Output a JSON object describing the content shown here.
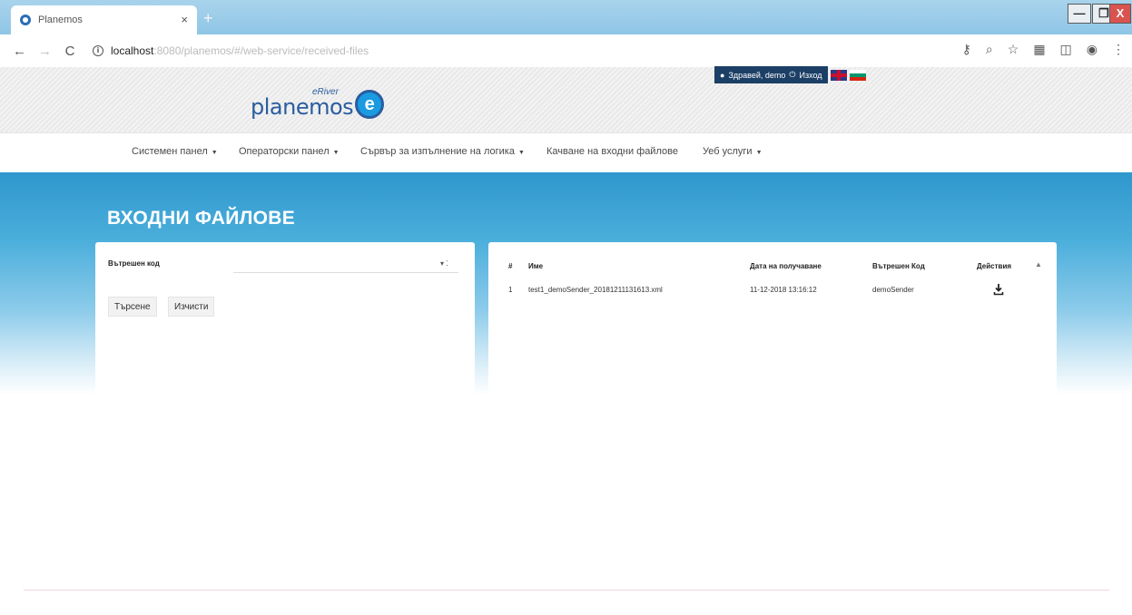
{
  "browser": {
    "tab_title": "Planemos",
    "tab_close": "×",
    "new_tab": "+",
    "url_host": "localhost",
    "url_rest": ":8080/planemos/#/web-service/received-files",
    "window_controls": {
      "minimize": "—",
      "maximize": "❐",
      "close": "X"
    }
  },
  "header": {
    "logo_text": "planemos",
    "logo_sub": "eRiver",
    "logo_mark": "e",
    "user_greeting": "Здравей, demo",
    "logout_label": "Изход"
  },
  "nav": {
    "items": [
      {
        "label": "Системен панел",
        "caret": true
      },
      {
        "label": "Операторски панел",
        "caret": true
      },
      {
        "label": "Сървър за изпълнение на логика",
        "caret": true
      },
      {
        "label": "Качване на входни файлове",
        "caret": false
      },
      {
        "label": "Уеб услуги",
        "caret": true
      }
    ]
  },
  "page": {
    "title": "ВХОДНИ ФАЙЛОВЕ"
  },
  "filter": {
    "internal_code_label": "Вътрешен код",
    "internal_code_value": "",
    "search_button": "Търсене",
    "clear_button": "Изчисти"
  },
  "table": {
    "headers": {
      "num": "#",
      "name": "Име",
      "date": "Дата на получаване",
      "code": "Вътрешен Код",
      "actions": "Действия"
    },
    "rows": [
      {
        "num": "1",
        "name": "test1_demoSender_20181211131613.xml",
        "date": "11-12-2018 13:16:12",
        "code": "demoSender"
      }
    ]
  },
  "icons": {
    "download": "download-icon",
    "sort": "sort-icon",
    "user": "user-icon",
    "power": "power-icon"
  },
  "colors": {
    "hero_blue": "#2f97cd",
    "userbar_navy": "#1c3f66",
    "brand_blue": "#2a5d9f"
  }
}
